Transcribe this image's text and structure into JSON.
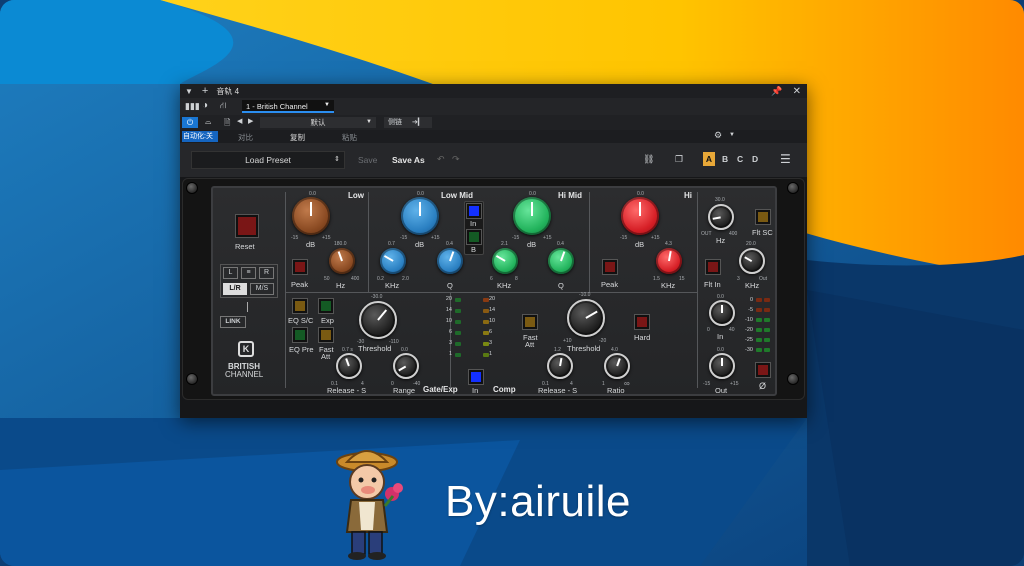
{
  "window": {
    "track_title": "音轨 4",
    "plugin_name": "1 - British Channel",
    "preset_default": "默认",
    "sidechain_label": "侧链",
    "automation_label": "自动化:关",
    "compare_label": "对比",
    "copy_label": "复制",
    "paste_label": "粘贴"
  },
  "toolbar": {
    "load_preset": "Load Preset",
    "save": "Save",
    "save_as": "Save As",
    "slots": [
      "A",
      "B",
      "C",
      "D"
    ]
  },
  "plugin": {
    "brand_line1": "BRITISH",
    "brand_line2": "CHANNEL",
    "reset": "Reset",
    "routing": {
      "l": "L",
      "stereo": "≡",
      "r": "R",
      "lr": "L/R",
      "ms": "M/S",
      "link": "LINK"
    },
    "sections": {
      "low": "Low",
      "low_mid": "Low Mid",
      "hi_mid": "Hi Mid",
      "hi": "Hi",
      "gate": "Gate/Exp",
      "comp": "Comp"
    },
    "labels": {
      "db": "dB",
      "hz": "Hz",
      "khz": "KHz",
      "q": "Q",
      "peak": "Peak",
      "in": "In",
      "b": "B",
      "flt_in": "Flt In",
      "flt_sc": "Flt SC",
      "eq_sc": "EQ S/C",
      "exp": "Exp",
      "eq_pre": "EQ Pre",
      "fast": "Fast",
      "att": "Att",
      "threshold": "Threshold",
      "release_s": "Release - S",
      "range": "Range",
      "hard": "Hard",
      "ratio": "Ratio",
      "out": "Out",
      "phase": "Ø"
    },
    "values": {
      "low_gain": "0.0",
      "low_freq": "180.0",
      "lm_gain": "0.0",
      "lm_freq": "0.7",
      "lm_q": "0.4",
      "hm_gain": "0.0",
      "hm_freq": "2.1",
      "hm_q": "0.4",
      "hi_gain": "0.0",
      "hi_freq": "4.3",
      "hpf": "30.0",
      "lpf": "20.0",
      "gate_thr": "-30.0",
      "gate_rel": "0.7 s",
      "gate_range": "0.0",
      "comp_thr": "-10.0",
      "comp_rel": "1.2",
      "comp_ratio": "4.0",
      "in_gain": "0.0",
      "out_gain": "0.0"
    },
    "ranges": {
      "gain_min": "-15",
      "gain_max": "+15",
      "lf_min": "50",
      "lf_max": "400",
      "lm_min": "0.2",
      "lm_max": "2.0",
      "hm_min": "6",
      "hm_max": "8",
      "hf_min": "1.5",
      "hf_max": "15",
      "hpf_min": "OUT",
      "hpf_max": "400",
      "lpf_min": "3",
      "lpf_max": "Out",
      "gthr_min": "-30",
      "gthr_max": "-110",
      "grel_min": "0.1",
      "grel_max": "4",
      "grange_min": "0",
      "grange_max": "-40",
      "cthr_min": "+10",
      "cthr_max": "-20",
      "crel_min": "0.1",
      "crel_max": "4",
      "ratio_min": "1",
      "ratio_max": "∞",
      "io_min": "0",
      "io_max": "40"
    },
    "gate_meter": [
      "20",
      "14",
      "10",
      "6",
      "3",
      "1"
    ],
    "comp_meter": [
      "20",
      "14",
      "10",
      "6",
      "3",
      "1"
    ],
    "out_meter": [
      "0",
      "-5",
      "-10",
      "-20",
      "-25",
      "-30"
    ]
  },
  "watermark": "By:airuile",
  "colors": {
    "accent_blue": "#1976d2",
    "slot_active": "#e8a838"
  }
}
